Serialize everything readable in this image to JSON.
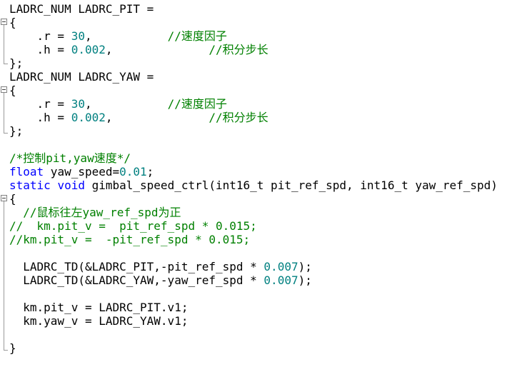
{
  "colors": {
    "plain": "#000000",
    "keyword": "#0000ff",
    "number": "#008080",
    "comment": "#008000",
    "fold_marker": "#808080"
  },
  "lines": [
    {
      "tokens": [
        {
          "type": "plain",
          "text": "LADRC_NUM LADRC_PIT ="
        }
      ]
    },
    {
      "tokens": [
        {
          "type": "plain",
          "text": "{"
        }
      ]
    },
    {
      "tokens": [
        {
          "type": "plain",
          "text": "    .r = "
        },
        {
          "type": "number",
          "text": "30"
        },
        {
          "type": "plain",
          "text": ",           "
        },
        {
          "type": "comment",
          "text": "//速度因子"
        }
      ]
    },
    {
      "tokens": [
        {
          "type": "plain",
          "text": "    .h = "
        },
        {
          "type": "number",
          "text": "0.002"
        },
        {
          "type": "plain",
          "text": ",              "
        },
        {
          "type": "comment",
          "text": "//积分步长"
        }
      ]
    },
    {
      "tokens": [
        {
          "type": "plain",
          "text": "};"
        }
      ]
    },
    {
      "tokens": [
        {
          "type": "plain",
          "text": "LADRC_NUM LADRC_YAW ="
        }
      ]
    },
    {
      "tokens": [
        {
          "type": "plain",
          "text": "{"
        }
      ]
    },
    {
      "tokens": [
        {
          "type": "plain",
          "text": "    .r = "
        },
        {
          "type": "number",
          "text": "30"
        },
        {
          "type": "plain",
          "text": ",           "
        },
        {
          "type": "comment",
          "text": "//速度因子"
        }
      ]
    },
    {
      "tokens": [
        {
          "type": "plain",
          "text": "    .h = "
        },
        {
          "type": "number",
          "text": "0.002"
        },
        {
          "type": "plain",
          "text": ",              "
        },
        {
          "type": "comment",
          "text": "//积分步长"
        }
      ]
    },
    {
      "tokens": [
        {
          "type": "plain",
          "text": "};"
        }
      ]
    },
    {
      "tokens": []
    },
    {
      "tokens": [
        {
          "type": "comment",
          "text": "/*控制pit,yaw速度*/"
        }
      ]
    },
    {
      "tokens": [
        {
          "type": "keyword",
          "text": "float"
        },
        {
          "type": "plain",
          "text": " yaw_speed="
        },
        {
          "type": "number",
          "text": "0.01"
        },
        {
          "type": "plain",
          "text": ";"
        }
      ]
    },
    {
      "tokens": [
        {
          "type": "keyword",
          "text": "static"
        },
        {
          "type": "plain",
          "text": " "
        },
        {
          "type": "keyword",
          "text": "void"
        },
        {
          "type": "plain",
          "text": " gimbal_speed_ctrl(int16_t pit_ref_spd, int16_t yaw_ref_spd)"
        }
      ]
    },
    {
      "tokens": [
        {
          "type": "plain",
          "text": "{"
        }
      ]
    },
    {
      "tokens": [
        {
          "type": "comment",
          "text": "  //鼠标往左yaw_ref_spd为正"
        }
      ]
    },
    {
      "tokens": [
        {
          "type": "comment",
          "text": "//  km.pit_v =  pit_ref_spd * 0.015;"
        }
      ]
    },
    {
      "tokens": [
        {
          "type": "comment",
          "text": "//km.pit_v =  -pit_ref_spd * 0.015;"
        }
      ]
    },
    {
      "tokens": []
    },
    {
      "tokens": [
        {
          "type": "plain",
          "text": "  LADRC_TD(&LADRC_PIT,-pit_ref_spd * "
        },
        {
          "type": "number",
          "text": "0.007"
        },
        {
          "type": "plain",
          "text": ");"
        }
      ]
    },
    {
      "tokens": [
        {
          "type": "plain",
          "text": "  LADRC_TD(&LADRC_YAW,-yaw_ref_spd * "
        },
        {
          "type": "number",
          "text": "0.007"
        },
        {
          "type": "plain",
          "text": ");"
        }
      ]
    },
    {
      "tokens": []
    },
    {
      "tokens": [
        {
          "type": "plain",
          "text": "  km.pit_v = LADRC_PIT.v1;"
        }
      ]
    },
    {
      "tokens": [
        {
          "type": "plain",
          "text": "  km.yaw_v = LADRC_YAW.v1;"
        }
      ]
    },
    {
      "tokens": []
    },
    {
      "tokens": [
        {
          "type": "plain",
          "text": "}"
        }
      ]
    }
  ]
}
